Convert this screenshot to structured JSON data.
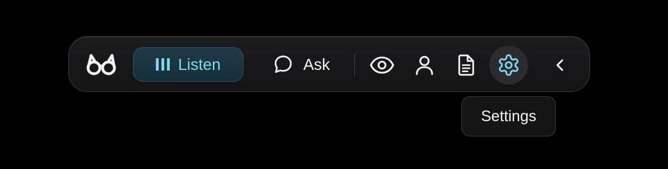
{
  "toolbar": {
    "logo_icon": "glasses-logo-icon",
    "listen": {
      "label": "Listen",
      "icon": "audio-bars-icon",
      "active": true
    },
    "ask": {
      "label": "Ask",
      "icon": "chat-bubble-icon"
    },
    "icons": [
      {
        "name": "eye-icon"
      },
      {
        "name": "user-icon"
      },
      {
        "name": "document-icon"
      },
      {
        "name": "gear-icon",
        "active": true
      },
      {
        "name": "chevron-left-icon"
      }
    ]
  },
  "tooltip": {
    "text": "Settings"
  },
  "colors": {
    "background": "#000000",
    "toolbar_bg": "#1a1a1c",
    "accent": "#7fd6ea",
    "listen_bg": "#1f3a45",
    "text": "#f2f2f2"
  }
}
